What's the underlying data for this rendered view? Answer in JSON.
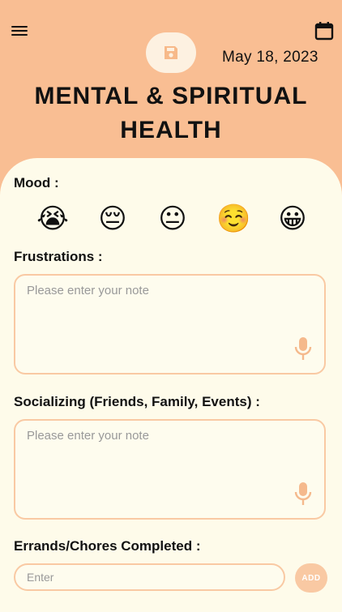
{
  "header": {
    "date": "May 18, 2023",
    "title": "MENTAL & SPIRITUAL HEALTH",
    "icons": {
      "menu": "menu-icon",
      "calendar": "calendar-icon",
      "save": "save-icon"
    }
  },
  "mood": {
    "label": "Mood :",
    "options": [
      {
        "emoji": "😭",
        "name": "crying"
      },
      {
        "emoji": "😔",
        "name": "pensive"
      },
      {
        "emoji": "😐",
        "name": "neutral"
      },
      {
        "emoji": "☺️",
        "name": "smiling"
      },
      {
        "emoji": "😀",
        "name": "grinning"
      }
    ]
  },
  "frustrations": {
    "label": "Frustrations :",
    "placeholder": "Please enter your note"
  },
  "socializing": {
    "label": "Socializing (Friends, Family, Events) :",
    "placeholder": "Please enter your note"
  },
  "errands": {
    "label": "Errands/Chores Completed :",
    "placeholder": "Enter",
    "add_label": "ADD"
  },
  "colors": {
    "header_bg": "#f9be93",
    "sheet_bg": "#fefbea",
    "field_border": "#f9c9a3",
    "mic": "#f5b98c"
  }
}
